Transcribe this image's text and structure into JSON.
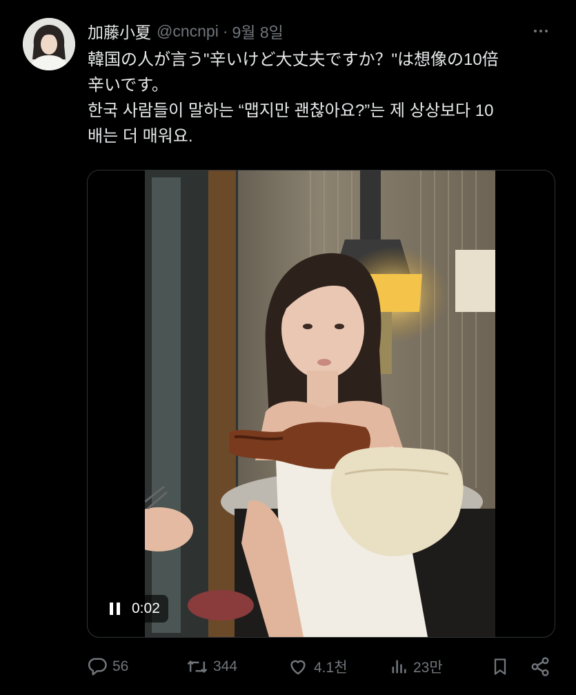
{
  "tweet": {
    "author": {
      "display_name": "加藤小夏",
      "handle": "@cncnpi",
      "date": "9월 8일",
      "separator": "·"
    },
    "text_lines": [
      "韓国の人が言う\"辛いけど大丈夫ですか？\"は想像の10倍",
      "辛いです。",
      "한국 사람들이 말하는 “맵지만 괜찮아요?”는 제 상상보다 10",
      "배는 더 매워요."
    ],
    "media": {
      "type": "video",
      "state": "playing",
      "timestamp": "0:02"
    },
    "actions": {
      "replies": "56",
      "reposts": "344",
      "likes": "4.1천",
      "views": "23만"
    }
  },
  "icons": {
    "more": "more-horizontal-icon",
    "reply": "reply-icon",
    "repost": "repost-icon",
    "like": "heart-icon",
    "views": "views-bar-chart-icon",
    "bookmark": "bookmark-icon",
    "share": "share-icon",
    "pause": "pause-icon"
  },
  "colors": {
    "background": "#000000",
    "text": "#e7e9ea",
    "secondary": "#71767b",
    "border": "#2f3336"
  }
}
